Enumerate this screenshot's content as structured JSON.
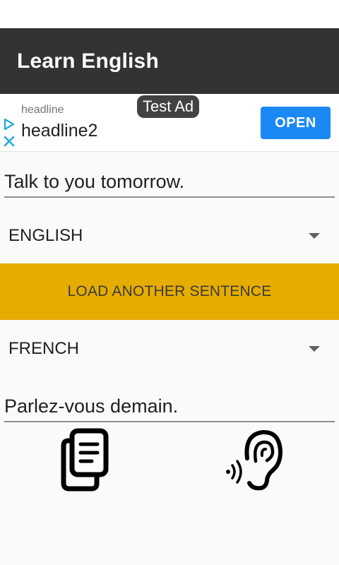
{
  "app_bar": {
    "title": "Learn English"
  },
  "ad": {
    "badge": "Test Ad",
    "headline": "headline",
    "headline2": "headline2",
    "cta_label": "OPEN",
    "cta_color": "#1a88f5"
  },
  "source": {
    "text": "Talk to you tomorrow.",
    "language": "ENGLISH"
  },
  "load_button": {
    "label": "LOAD ANOTHER SENTENCE",
    "color": "#e6ac00"
  },
  "target": {
    "language": "FRENCH",
    "text": "Parlez-vous demain."
  },
  "icons": {
    "copy": "copy-icon",
    "listen": "ear-sound-icon",
    "dropdown": "chevron-down-icon",
    "ad_choices": "ad-choices-icon"
  },
  "colors": {
    "app_bar": "#333333",
    "background": "#fafafa"
  }
}
